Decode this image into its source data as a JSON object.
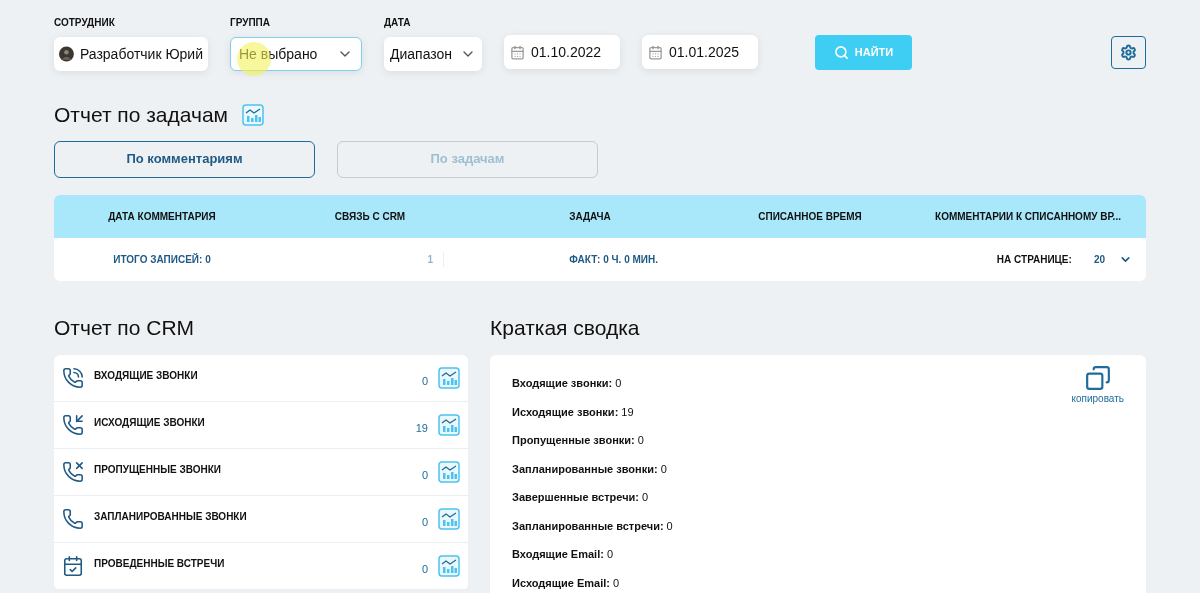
{
  "filters": {
    "employee": {
      "label": "СОТРУДНИК",
      "value": "Разработчик Юрий"
    },
    "group": {
      "label": "ГРУППА",
      "value": "Не выбрано",
      "focused": true
    },
    "date": {
      "label": "ДАТА",
      "mode": "Диапазон",
      "from": "01.10.2022",
      "to": "01.01.2025"
    },
    "search_button": "НАЙТИ"
  },
  "task_report": {
    "title": "Отчет по задачам",
    "tabs": [
      {
        "label": "По комментариям",
        "selected": true
      },
      {
        "label": "По задачам",
        "selected": false
      }
    ],
    "table": {
      "columns": [
        "ДАТА КОММЕНТАРИЯ",
        "СВЯЗЬ С CRM",
        "ЗАДАЧА",
        "СПИСАННОЕ ВРЕМЯ",
        "КОММЕНТАРИИ К СПИСАННОМУ ВР..."
      ],
      "footer": {
        "total": "ИТОГО ЗАПИСЕЙ: 0",
        "page": "1",
        "fact": "ФАКТ: 0 Ч. 0 МИН.",
        "per_page_label": "НА СТРАНИЦЕ:",
        "per_page": "20"
      }
    }
  },
  "crm_report": {
    "title": "Отчет по CRM",
    "items": [
      {
        "kind": "incoming",
        "label": "ВХОДЯЩИЕ ЗВОНКИ",
        "count": "0"
      },
      {
        "kind": "outgoing",
        "label": "ИСХОДЯЩИЕ ЗВОНКИ",
        "count": "19"
      },
      {
        "kind": "missed",
        "label": "ПРОПУЩЕННЫЕ ЗВОНКИ",
        "count": "0"
      },
      {
        "kind": "scheduled",
        "label": "ЗАПЛАНИРОВАННЫЕ ЗВОНКИ",
        "count": "0"
      },
      {
        "kind": "meeting",
        "label": "ПРОВЕДЕННЫЕ ВСТРЕЧИ",
        "count": "0"
      }
    ]
  },
  "summary": {
    "title": "Краткая сводка",
    "copy_label": "копировать",
    "lines": [
      "**Входящие звонки:** 0",
      "**Исходящие звонки:** 19",
      "**Пропущенные звонки:** 0",
      "**Запланированные звонки:** 0",
      "**Завершенные встречи:** 0",
      "**Запланированные встречи:** 0",
      "**Входящие Email:** 0",
      "**Исходящие Email:** 0"
    ]
  }
}
